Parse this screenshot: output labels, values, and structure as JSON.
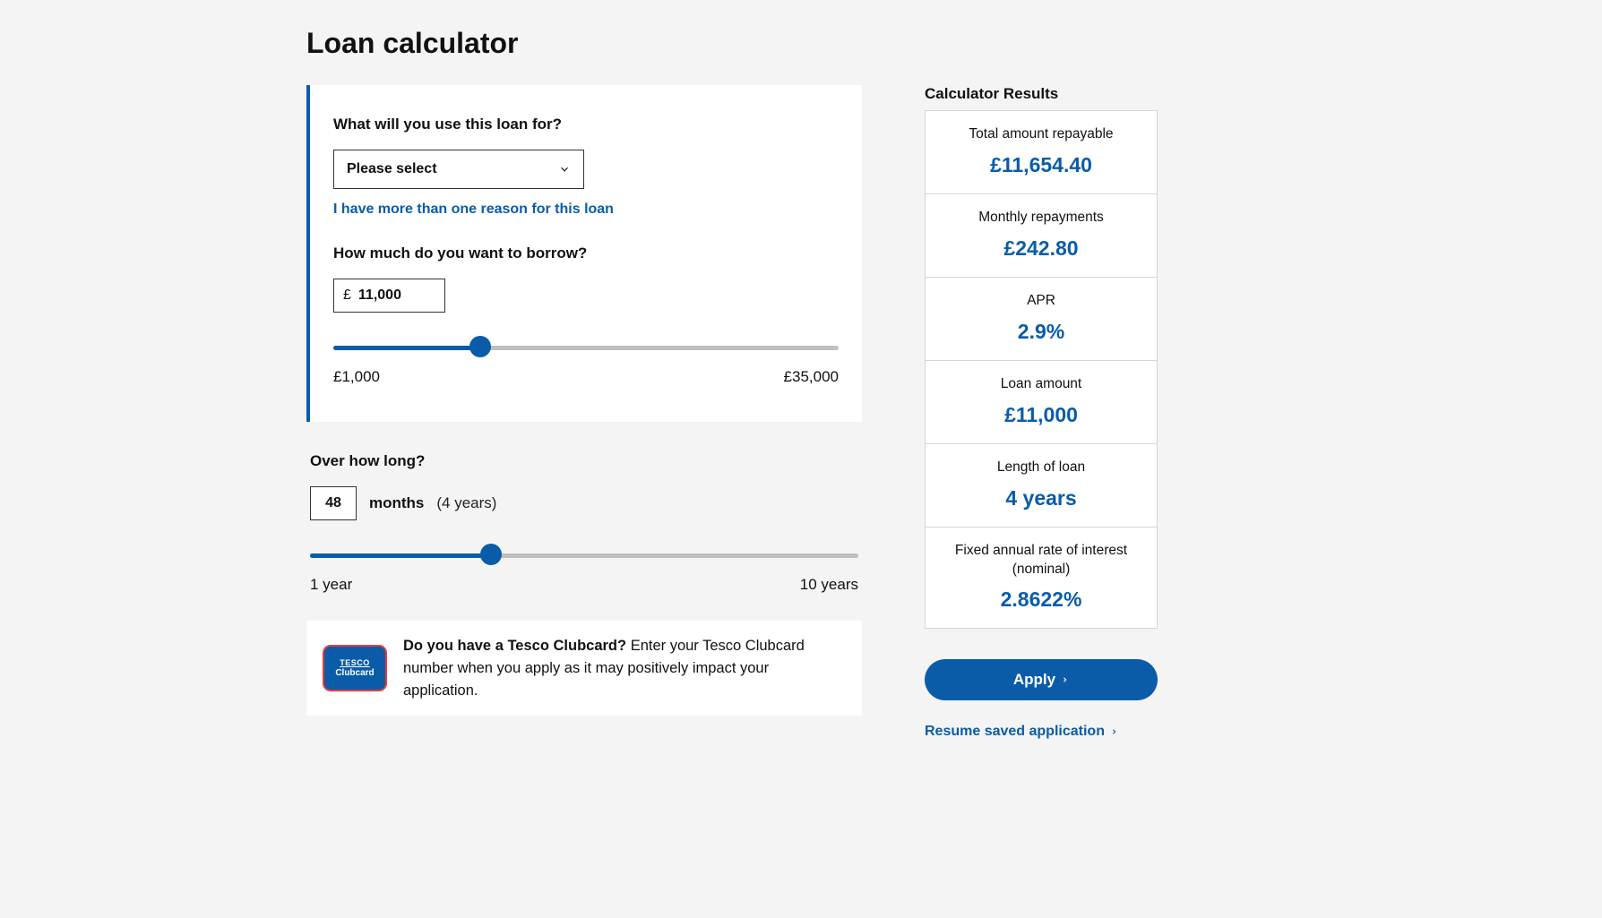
{
  "title": "Loan calculator",
  "form": {
    "purpose": {
      "label": "What will you use this loan for?",
      "placeholder": "Please select",
      "multi_reason_link": "I have more than one reason for this loan"
    },
    "amount": {
      "label": "How much do you want to borrow?",
      "currency": "£",
      "value": "11,000",
      "min_label": "£1,000",
      "max_label": "£35,000",
      "slider_pct": 29
    },
    "term": {
      "label": "Over how long?",
      "months_value": "48",
      "months_unit": "months",
      "years_hint": "(4 years)",
      "min_label": "1 year",
      "max_label": "10 years",
      "slider_pct": 33
    },
    "clubcard": {
      "badge_line1": "TESCO",
      "badge_line2": "Clubcard",
      "bold": "Do you have a Tesco Clubcard?",
      "rest": "Enter your Tesco Clubcard number when you apply as it may positively impact your application."
    }
  },
  "results": {
    "title": "Calculator Results",
    "rows": [
      {
        "label": "Total amount repayable",
        "value": "£11,654.40"
      },
      {
        "label": "Monthly repayments",
        "value": "£242.80"
      },
      {
        "label": "APR",
        "value": "2.9%"
      },
      {
        "label": "Loan amount",
        "value": "£11,000"
      },
      {
        "label": "Length of loan",
        "value": "4 years"
      },
      {
        "label": "Fixed annual rate of interest (nominal)",
        "value": "2.8622%"
      }
    ],
    "apply_label": "Apply",
    "resume_label": "Resume saved application"
  }
}
